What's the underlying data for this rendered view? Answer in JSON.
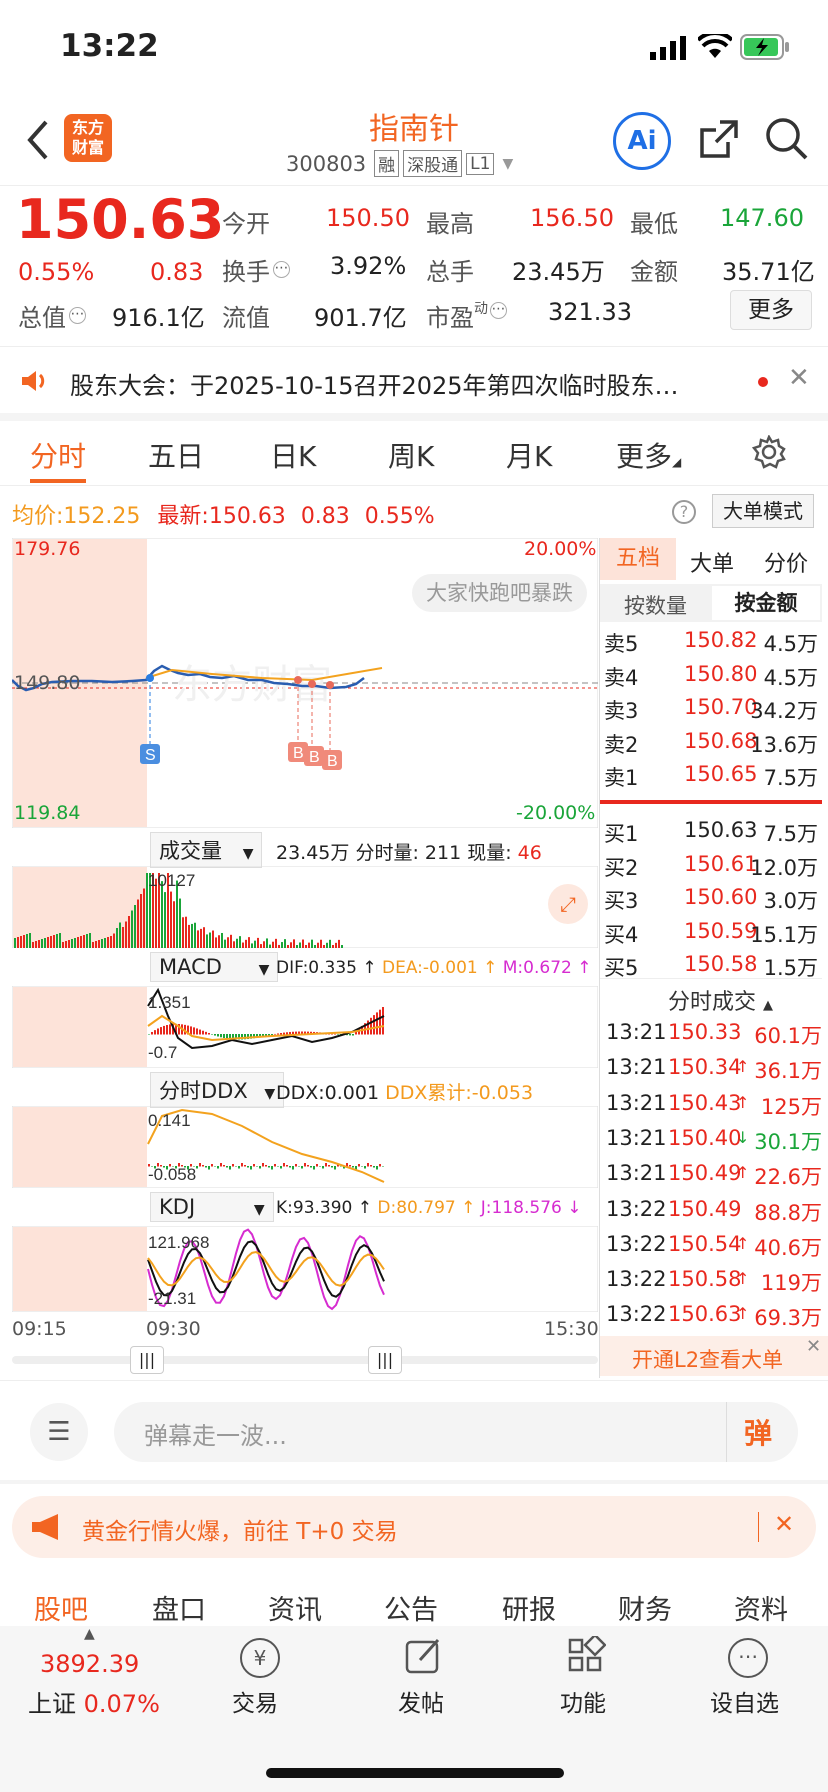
{
  "status": {
    "time": "13:22"
  },
  "header": {
    "title": "指南针",
    "code": "300803",
    "tags": [
      "融",
      "深股通",
      "L1"
    ],
    "logo_text": "东方\n财富",
    "ai": "Ai"
  },
  "quote": {
    "price": "150.63",
    "change_pct": "0.55%",
    "change": "0.83",
    "f": [
      {
        "k": "今开",
        "v": "150.50"
      },
      {
        "k": "最高",
        "v": "156.50"
      },
      {
        "k": "最低",
        "v": "147.60"
      },
      {
        "k": "换手",
        "v": "3.92%"
      },
      {
        "k": "总手",
        "v": "23.45万"
      },
      {
        "k": "金额",
        "v": "35.71亿"
      },
      {
        "k": "总值",
        "v": "916.1亿"
      },
      {
        "k": "流值",
        "v": "901.7亿"
      },
      {
        "k": "市盈",
        "sup": "动",
        "v": "321.33"
      }
    ],
    "more": "更多"
  },
  "notice": {
    "text": "股东大会：于2025-10-15召开2025年第四次临时股东…"
  },
  "tabs": [
    "分时",
    "五日",
    "日K",
    "周K",
    "月K",
    "更多"
  ],
  "chartinfo": {
    "avg_label": "均价:",
    "avg": "152.25",
    "latest_label": "最新:",
    "latest": "150.63",
    "chg": "0.83",
    "pct": "0.55%",
    "mode": "大单模式"
  },
  "chart": {
    "ymax": "179.76",
    "ymid": "149.80",
    "ymin": "119.84",
    "pmax": "20.00%",
    "pmin": "-20.00%",
    "danmaku": "大家快跑吧暴跌",
    "watermark": "东方财富",
    "xstart": "09:15",
    "xmid": "09:30",
    "xend": "15:30",
    "s_mark": "S",
    "b_mark": "B"
  },
  "vol": {
    "sel": "成交量",
    "total": "23.45万",
    "fs_label": "分时量:",
    "fs": "211",
    "now_label": "现量:",
    "now": "46",
    "peak": "10127"
  },
  "macd": {
    "sel": "MACD",
    "dif": "DIF:0.335 ↑",
    "dea": "DEA:-0.001 ↑",
    "m": "M:0.672 ↑",
    "top": "1.351",
    "bot": "-0.7"
  },
  "ddx": {
    "sel": "分时DDX",
    "ddx": "DDX:0.001",
    "cum": "DDX累计:-0.053",
    "top": "0.141",
    "bot": "-0.058"
  },
  "kdj": {
    "sel": "KDJ",
    "k": "K:93.390 ↑",
    "d": "D:80.797 ↑",
    "j": "J:118.576 ↓",
    "top": "121.968",
    "bot": "-21.31"
  },
  "orderbook": {
    "tabs": [
      "五档",
      "大单",
      "分价"
    ],
    "sub": [
      "按数量",
      "按金额"
    ],
    "sells": [
      {
        "l": "卖5",
        "p": "150.82",
        "v": "4.5万"
      },
      {
        "l": "卖4",
        "p": "150.80",
        "v": "4.5万"
      },
      {
        "l": "卖3",
        "p": "150.70",
        "v": "34.2万"
      },
      {
        "l": "卖2",
        "p": "150.68",
        "v": "13.6万"
      },
      {
        "l": "卖1",
        "p": "150.65",
        "v": "7.5万"
      }
    ],
    "buys": [
      {
        "l": "买1",
        "p": "150.63",
        "v": "7.5万"
      },
      {
        "l": "买2",
        "p": "150.61",
        "v": "12.0万"
      },
      {
        "l": "买3",
        "p": "150.60",
        "v": "3.0万"
      },
      {
        "l": "买4",
        "p": "150.59",
        "v": "15.1万"
      },
      {
        "l": "买5",
        "p": "150.58",
        "v": "1.5万"
      }
    ]
  },
  "trades": {
    "title": "分时成交",
    "rows": [
      {
        "t": "13:21",
        "p": "150.33",
        "a": "",
        "v": "60.1万"
      },
      {
        "t": "13:21",
        "p": "150.34",
        "a": "↑",
        "v": "36.1万"
      },
      {
        "t": "13:21",
        "p": "150.43",
        "a": "↑",
        "v": "125万"
      },
      {
        "t": "13:21",
        "p": "150.40",
        "a": "↓",
        "v": "30.1万"
      },
      {
        "t": "13:21",
        "p": "150.49",
        "a": "↑",
        "v": "22.6万"
      },
      {
        "t": "13:22",
        "p": "150.49",
        "a": "",
        "v": "88.8万"
      },
      {
        "t": "13:22",
        "p": "150.54",
        "a": "↑",
        "v": "40.6万"
      },
      {
        "t": "13:22",
        "p": "150.58",
        "a": "↑",
        "v": "119万"
      },
      {
        "t": "13:22",
        "p": "150.63",
        "a": "↑",
        "v": "69.3万"
      }
    ],
    "l2": "开通L2查看大单"
  },
  "comment": {
    "placeholder": "弹幕走一波...",
    "btn": "弹"
  },
  "promo": {
    "text": "黄金行情火爆，前往 T+0 交易"
  },
  "bottomtabs": [
    "股吧",
    "盘口",
    "资讯",
    "公告",
    "研报",
    "财务",
    "资料"
  ],
  "nav": {
    "index_val": "3892.39",
    "index_name": "上证",
    "index_pct": "0.07%",
    "items": [
      "交易",
      "发帖",
      "功能",
      "设自选"
    ]
  }
}
